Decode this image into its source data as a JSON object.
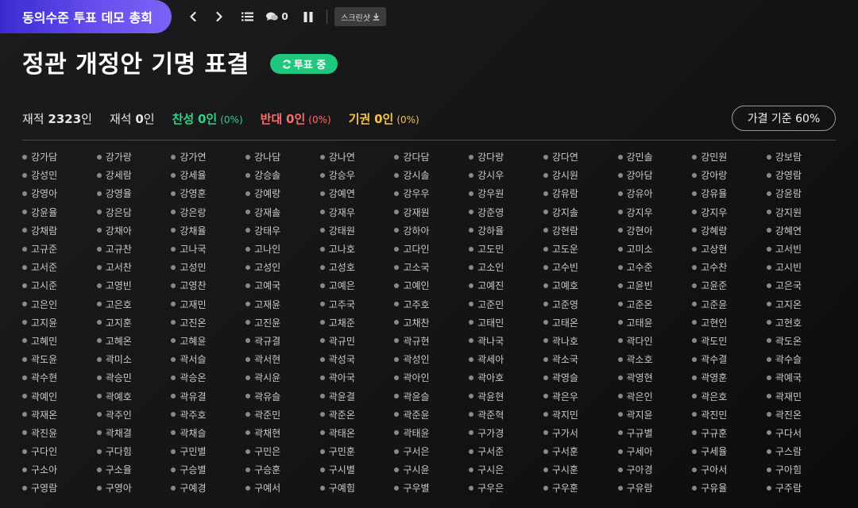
{
  "header": {
    "room_title": "동의수준 투표 데모 총회",
    "chat_count": "0",
    "screenshot_label": "스크린샷"
  },
  "title": "정관 개정안 기명 표결",
  "status_badge": "투표 중",
  "stats": {
    "present_label": "재적",
    "present_value": "2323",
    "present_unit": "인",
    "seated_label": "재석",
    "seated_value": "0",
    "seated_unit": "인",
    "yes_label": "찬성",
    "yes_value": "0인",
    "yes_pct": "(0%)",
    "no_label": "반대",
    "no_value": "0인",
    "no_pct": "(0%)",
    "abstain_label": "기권",
    "abstain_value": "0인",
    "abstain_pct": "(0%)"
  },
  "threshold": "가결 기준 60%",
  "colors": {
    "accent": "#6a4ff0",
    "yes": "#2fd486",
    "no": "#ff6b6b",
    "abstain": "#f5c542",
    "badge": "#1fc87c"
  },
  "voters": [
    "강가담",
    "강가랑",
    "강가연",
    "강나담",
    "강나연",
    "강다담",
    "강다랑",
    "강다연",
    "강민솔",
    "강민원",
    "강보람",
    "강성민",
    "강세람",
    "강세율",
    "강승솔",
    "강승우",
    "강시솔",
    "강시우",
    "강시원",
    "강아담",
    "강아랑",
    "강영람",
    "강영아",
    "강영율",
    "강영훈",
    "강예랑",
    "강예연",
    "강우우",
    "강우원",
    "강유람",
    "강유아",
    "강유율",
    "강윤람",
    "강윤율",
    "강은담",
    "강은랑",
    "강재솔",
    "강재우",
    "강재원",
    "강준영",
    "강지솔",
    "강지우",
    "강지우",
    "강지원",
    "강채람",
    "강채아",
    "강채율",
    "강태우",
    "강태원",
    "강하아",
    "강하율",
    "강현람",
    "강현아",
    "강혜랑",
    "강혜연",
    "고규준",
    "고규찬",
    "고나국",
    "고나인",
    "고나호",
    "고다인",
    "고도민",
    "고도운",
    "고미소",
    "고상현",
    "고서빈",
    "고서준",
    "고서찬",
    "고성민",
    "고성인",
    "고성호",
    "고소국",
    "고소인",
    "고수빈",
    "고수준",
    "고수찬",
    "고시빈",
    "고시준",
    "고영빈",
    "고영찬",
    "고예국",
    "고예은",
    "고예인",
    "고예진",
    "고예호",
    "고윤빈",
    "고윤준",
    "고은국",
    "고은인",
    "고은호",
    "고재민",
    "고재윤",
    "고주국",
    "고주호",
    "고준민",
    "고준영",
    "고준온",
    "고준윤",
    "고지온",
    "고지윤",
    "고지훈",
    "고진온",
    "고진윤",
    "고채준",
    "고채찬",
    "고태민",
    "고태온",
    "고태윤",
    "고현인",
    "고현호",
    "고혜민",
    "고혜온",
    "고혜윤",
    "곽규결",
    "곽규민",
    "곽규현",
    "곽나국",
    "곽나호",
    "곽다인",
    "곽도민",
    "곽도온",
    "곽도윤",
    "곽미소",
    "곽서슬",
    "곽서현",
    "곽성국",
    "곽성인",
    "곽세아",
    "곽소국",
    "곽소호",
    "곽수결",
    "곽수슬",
    "곽수현",
    "곽승민",
    "곽승온",
    "곽시윤",
    "곽아국",
    "곽아인",
    "곽아호",
    "곽영슬",
    "곽영현",
    "곽영훈",
    "곽예국",
    "곽예인",
    "곽예호",
    "곽유결",
    "곽유슬",
    "곽윤결",
    "곽윤슬",
    "곽윤현",
    "곽은우",
    "곽은인",
    "곽은호",
    "곽재민",
    "곽재온",
    "곽주인",
    "곽주호",
    "곽준민",
    "곽준온",
    "곽준윤",
    "곽준혁",
    "곽지민",
    "곽지윤",
    "곽진민",
    "곽진온",
    "곽진윤",
    "곽채결",
    "곽채슬",
    "곽채현",
    "곽태온",
    "곽태윤",
    "구가경",
    "구가서",
    "구규별",
    "구규훈",
    "구다서",
    "구다인",
    "구다힘",
    "구민별",
    "구민은",
    "구민훈",
    "구서은",
    "구서준",
    "구서훈",
    "구세아",
    "구세율",
    "구스람",
    "구소아",
    "구소율",
    "구승별",
    "구승훈",
    "구시별",
    "구시윤",
    "구시은",
    "구시훈",
    "구아경",
    "구아서",
    "구아힘",
    "구영람",
    "구영아",
    "구예경",
    "구예서",
    "구예힘",
    "구우별",
    "구우은",
    "구우훈",
    "구유람",
    "구유율",
    "구주람"
  ]
}
